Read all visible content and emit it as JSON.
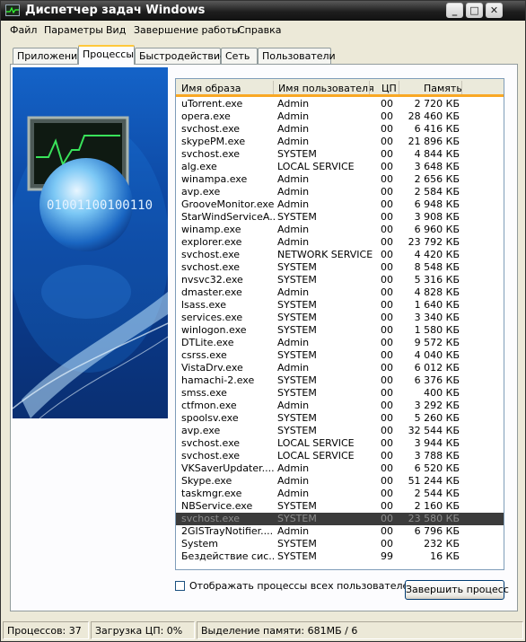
{
  "window": {
    "title": "Диспетчер задач Windows",
    "minimize_label": "_",
    "maximize_label": "□",
    "close_label": "✕"
  },
  "menu": [
    "Файл",
    "Параметры",
    "Вид",
    "Завершение работы",
    "Справка"
  ],
  "tabs": [
    "Приложения",
    "Процессы",
    "Быстродействие",
    "Сеть",
    "Пользователи"
  ],
  "active_tab": "Процессы",
  "artwork": {
    "binary_text": "01001100100110",
    "icon": "globe-monitor-artwork"
  },
  "columns": {
    "name": "Имя образа",
    "user": "Имя пользователя",
    "cpu": "ЦП",
    "mem": "Память"
  },
  "processes": [
    {
      "name": "uTorrent.exe",
      "user": "Admin",
      "cpu": "00",
      "mem": "2 720 КБ"
    },
    {
      "name": "opera.exe",
      "user": "Admin",
      "cpu": "00",
      "mem": "28 460 КБ"
    },
    {
      "name": "svchost.exe",
      "user": "Admin",
      "cpu": "00",
      "mem": "6 416 КБ"
    },
    {
      "name": "skypePM.exe",
      "user": "Admin",
      "cpu": "00",
      "mem": "21 896 КБ"
    },
    {
      "name": "svchost.exe",
      "user": "SYSTEM",
      "cpu": "00",
      "mem": "4 844 КБ"
    },
    {
      "name": "alg.exe",
      "user": "LOCAL SERVICE",
      "cpu": "00",
      "mem": "3 648 КБ"
    },
    {
      "name": "winampa.exe",
      "user": "Admin",
      "cpu": "00",
      "mem": "2 656 КБ"
    },
    {
      "name": "avp.exe",
      "user": "Admin",
      "cpu": "00",
      "mem": "2 584 КБ"
    },
    {
      "name": "GrooveMonitor.exe",
      "user": "Admin",
      "cpu": "00",
      "mem": "6 948 КБ"
    },
    {
      "name": "StarWindServiceA...",
      "user": "SYSTEM",
      "cpu": "00",
      "mem": "3 908 КБ"
    },
    {
      "name": "winamp.exe",
      "user": "Admin",
      "cpu": "00",
      "mem": "6 960 КБ"
    },
    {
      "name": "explorer.exe",
      "user": "Admin",
      "cpu": "00",
      "mem": "23 792 КБ"
    },
    {
      "name": "svchost.exe",
      "user": "NETWORK SERVICE",
      "cpu": "00",
      "mem": "4 420 КБ"
    },
    {
      "name": "svchost.exe",
      "user": "SYSTEM",
      "cpu": "00",
      "mem": "8 548 КБ"
    },
    {
      "name": "nvsvc32.exe",
      "user": "SYSTEM",
      "cpu": "00",
      "mem": "5 316 КБ"
    },
    {
      "name": "dmaster.exe",
      "user": "Admin",
      "cpu": "00",
      "mem": "4 828 КБ"
    },
    {
      "name": "lsass.exe",
      "user": "SYSTEM",
      "cpu": "00",
      "mem": "1 640 КБ"
    },
    {
      "name": "services.exe",
      "user": "SYSTEM",
      "cpu": "00",
      "mem": "3 340 КБ"
    },
    {
      "name": "winlogon.exe",
      "user": "SYSTEM",
      "cpu": "00",
      "mem": "1 580 КБ"
    },
    {
      "name": "DTLite.exe",
      "user": "Admin",
      "cpu": "00",
      "mem": "9 572 КБ"
    },
    {
      "name": "csrss.exe",
      "user": "SYSTEM",
      "cpu": "00",
      "mem": "4 040 КБ"
    },
    {
      "name": "VistaDrv.exe",
      "user": "Admin",
      "cpu": "00",
      "mem": "6 012 КБ"
    },
    {
      "name": "hamachi-2.exe",
      "user": "SYSTEM",
      "cpu": "00",
      "mem": "6 376 КБ"
    },
    {
      "name": "smss.exe",
      "user": "SYSTEM",
      "cpu": "00",
      "mem": "400 КБ"
    },
    {
      "name": "ctfmon.exe",
      "user": "Admin",
      "cpu": "00",
      "mem": "3 292 КБ"
    },
    {
      "name": "spoolsv.exe",
      "user": "SYSTEM",
      "cpu": "00",
      "mem": "5 260 КБ"
    },
    {
      "name": "avp.exe",
      "user": "SYSTEM",
      "cpu": "00",
      "mem": "32 544 КБ"
    },
    {
      "name": "svchost.exe",
      "user": "LOCAL SERVICE",
      "cpu": "00",
      "mem": "3 944 КБ"
    },
    {
      "name": "svchost.exe",
      "user": "LOCAL SERVICE",
      "cpu": "00",
      "mem": "3 788 КБ"
    },
    {
      "name": "VKSaverUpdater....",
      "user": "Admin",
      "cpu": "00",
      "mem": "6 520 КБ"
    },
    {
      "name": "Skype.exe",
      "user": "Admin",
      "cpu": "00",
      "mem": "51 244 КБ"
    },
    {
      "name": "taskmgr.exe",
      "user": "Admin",
      "cpu": "00",
      "mem": "2 544 КБ"
    },
    {
      "name": "NBService.exe",
      "user": "SYSTEM",
      "cpu": "00",
      "mem": "2 160 КБ"
    },
    {
      "name": "svchost.exe",
      "user": "SYSTEM",
      "cpu": "00",
      "mem": "23 580 КБ",
      "selected": true
    },
    {
      "name": "2GISTrayNotifier....",
      "user": "Admin",
      "cpu": "00",
      "mem": "6 796 КБ"
    },
    {
      "name": "System",
      "user": "SYSTEM",
      "cpu": "00",
      "mem": "232 КБ"
    },
    {
      "name": "Бездействие сис...",
      "user": "SYSTEM",
      "cpu": "99",
      "mem": "16 КБ"
    }
  ],
  "show_all_label": "Отображать процессы всех пользователей",
  "show_all_checked": false,
  "end_process_label": "Завершить процесс",
  "status": {
    "processes": "Процессов: 37",
    "cpu": "Загрузка ЦП: 0%",
    "memory": "Выделение памяти: 681МБ / 6"
  }
}
